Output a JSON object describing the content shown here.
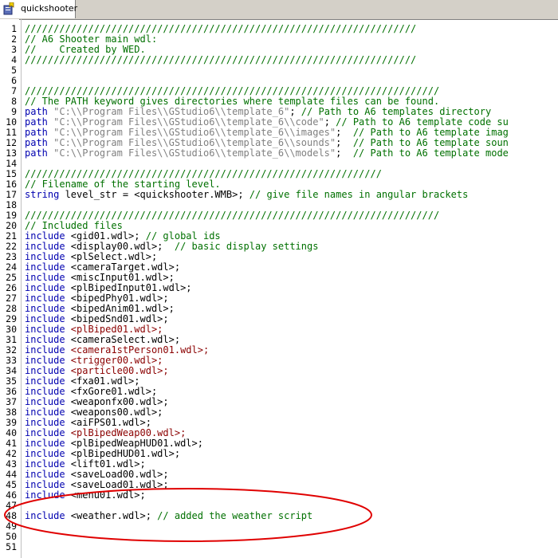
{
  "tab": {
    "label": "quickshooter",
    "icon": "script-file-icon"
  },
  "lines": [
    {
      "n": "1",
      "parts": [
        {
          "t": "////////////////////////////////////////////////////////////////////",
          "c": "comment"
        }
      ]
    },
    {
      "n": "2",
      "parts": [
        {
          "t": "// A6 Shooter main wdl:",
          "c": "comment"
        }
      ]
    },
    {
      "n": "3",
      "parts": [
        {
          "t": "//    Created by WED.",
          "c": "comment"
        }
      ]
    },
    {
      "n": "4",
      "parts": [
        {
          "t": "////////////////////////////////////////////////////////////////////",
          "c": "comment"
        }
      ]
    },
    {
      "n": "5",
      "parts": []
    },
    {
      "n": "6",
      "parts": []
    },
    {
      "n": "7",
      "parts": [
        {
          "t": "////////////////////////////////////////////////////////////////////////",
          "c": "comment"
        }
      ]
    },
    {
      "n": "8",
      "parts": [
        {
          "t": "// The PATH keyword gives directories where template files can be found.",
          "c": "comment"
        }
      ]
    },
    {
      "n": "9",
      "parts": [
        {
          "t": "path ",
          "c": "kw"
        },
        {
          "t": "\"C:\\\\Program Files\\\\GStudio6\\\\template_6\"",
          "c": "str"
        },
        {
          "t": "; ",
          "c": "plain"
        },
        {
          "t": "// Path to A6 templates directory",
          "c": "comment"
        }
      ]
    },
    {
      "n": "10",
      "parts": [
        {
          "t": "path ",
          "c": "kw"
        },
        {
          "t": "\"C:\\\\Program Files\\\\GStudio6\\\\template_6\\\\code\"",
          "c": "str"
        },
        {
          "t": "; ",
          "c": "plain"
        },
        {
          "t": "// Path to A6 template code su",
          "c": "comment"
        }
      ]
    },
    {
      "n": "11",
      "parts": [
        {
          "t": "path ",
          "c": "kw"
        },
        {
          "t": "\"C:\\\\Program Files\\\\GStudio6\\\\template_6\\\\images\"",
          "c": "str"
        },
        {
          "t": ";  ",
          "c": "plain"
        },
        {
          "t": "// Path to A6 template imag",
          "c": "comment"
        }
      ]
    },
    {
      "n": "12",
      "parts": [
        {
          "t": "path ",
          "c": "kw"
        },
        {
          "t": "\"C:\\\\Program Files\\\\GStudio6\\\\template_6\\\\sounds\"",
          "c": "str"
        },
        {
          "t": ";  ",
          "c": "plain"
        },
        {
          "t": "// Path to A6 template soun",
          "c": "comment"
        }
      ]
    },
    {
      "n": "13",
      "parts": [
        {
          "t": "path ",
          "c": "kw"
        },
        {
          "t": "\"C:\\\\Program Files\\\\GStudio6\\\\template_6\\\\models\"",
          "c": "str"
        },
        {
          "t": ";  ",
          "c": "plain"
        },
        {
          "t": "// Path to A6 template mode",
          "c": "comment"
        }
      ]
    },
    {
      "n": "14",
      "parts": []
    },
    {
      "n": "15",
      "parts": [
        {
          "t": "//////////////////////////////////////////////////////////////",
          "c": "comment"
        }
      ]
    },
    {
      "n": "16",
      "parts": [
        {
          "t": "// Filename of the starting level.",
          "c": "comment"
        }
      ]
    },
    {
      "n": "17",
      "parts": [
        {
          "t": "string ",
          "c": "kw"
        },
        {
          "t": "level_str = <quickshooter.WMB>; ",
          "c": "plain"
        },
        {
          "t": "// give file names in angular brackets",
          "c": "comment"
        }
      ]
    },
    {
      "n": "18",
      "parts": []
    },
    {
      "n": "19",
      "parts": [
        {
          "t": "////////////////////////////////////////////////////////////////////////",
          "c": "comment"
        }
      ]
    },
    {
      "n": "20",
      "parts": [
        {
          "t": "// Included files",
          "c": "comment"
        }
      ]
    },
    {
      "n": "21",
      "parts": [
        {
          "t": "include ",
          "c": "kw"
        },
        {
          "t": "<gid01.wdl>; ",
          "c": "plain"
        },
        {
          "t": "// global ids",
          "c": "comment"
        }
      ]
    },
    {
      "n": "22",
      "parts": [
        {
          "t": "include ",
          "c": "kw"
        },
        {
          "t": "<display00.wdl>;  ",
          "c": "plain"
        },
        {
          "t": "// basic display settings",
          "c": "comment"
        }
      ]
    },
    {
      "n": "23",
      "parts": [
        {
          "t": "include ",
          "c": "kw"
        },
        {
          "t": "<plSelect.wdl>;",
          "c": "plain"
        }
      ]
    },
    {
      "n": "24",
      "parts": [
        {
          "t": "include ",
          "c": "kw"
        },
        {
          "t": "<cameraTarget.wdl>;",
          "c": "plain"
        }
      ]
    },
    {
      "n": "25",
      "parts": [
        {
          "t": "include ",
          "c": "kw"
        },
        {
          "t": "<miscInput01.wdl>;",
          "c": "plain"
        }
      ]
    },
    {
      "n": "26",
      "parts": [
        {
          "t": "include ",
          "c": "kw"
        },
        {
          "t": "<plBipedInput01.wdl>;",
          "c": "plain"
        }
      ]
    },
    {
      "n": "27",
      "parts": [
        {
          "t": "include ",
          "c": "kw"
        },
        {
          "t": "<bipedPhy01.wdl>;",
          "c": "plain"
        }
      ]
    },
    {
      "n": "28",
      "parts": [
        {
          "t": "include ",
          "c": "kw"
        },
        {
          "t": "<bipedAnim01.wdl>;",
          "c": "plain"
        }
      ]
    },
    {
      "n": "29",
      "parts": [
        {
          "t": "include ",
          "c": "kw"
        },
        {
          "t": "<bipedSnd01.wdl>;",
          "c": "plain"
        }
      ]
    },
    {
      "n": "30",
      "parts": [
        {
          "t": "include ",
          "c": "kw"
        },
        {
          "t": "<plBiped01.wdl>;",
          "c": "red"
        }
      ]
    },
    {
      "n": "31",
      "parts": [
        {
          "t": "include ",
          "c": "kw"
        },
        {
          "t": "<cameraSelect.wdl>;",
          "c": "plain"
        }
      ]
    },
    {
      "n": "32",
      "parts": [
        {
          "t": "include ",
          "c": "kw"
        },
        {
          "t": "<camera1stPerson01.wdl>;",
          "c": "red"
        }
      ]
    },
    {
      "n": "33",
      "parts": [
        {
          "t": "include ",
          "c": "kw"
        },
        {
          "t": "<trigger00.wdl>;",
          "c": "red"
        }
      ]
    },
    {
      "n": "34",
      "parts": [
        {
          "t": "include ",
          "c": "kw"
        },
        {
          "t": "<particle00.wdl>;",
          "c": "red"
        }
      ]
    },
    {
      "n": "35",
      "parts": [
        {
          "t": "include ",
          "c": "kw"
        },
        {
          "t": "<fxa01.wdl>;",
          "c": "plain"
        }
      ]
    },
    {
      "n": "36",
      "parts": [
        {
          "t": "include ",
          "c": "kw"
        },
        {
          "t": "<fxGore01.wdl>;",
          "c": "plain"
        }
      ]
    },
    {
      "n": "37",
      "parts": [
        {
          "t": "include ",
          "c": "kw"
        },
        {
          "t": "<weaponfx00.wdl>;",
          "c": "plain"
        }
      ]
    },
    {
      "n": "38",
      "parts": [
        {
          "t": "include ",
          "c": "kw"
        },
        {
          "t": "<weapons00.wdl>;",
          "c": "plain"
        }
      ]
    },
    {
      "n": "39",
      "parts": [
        {
          "t": "include ",
          "c": "kw"
        },
        {
          "t": "<aiFPS01.wdl>;",
          "c": "plain"
        }
      ]
    },
    {
      "n": "40",
      "parts": [
        {
          "t": "include ",
          "c": "kw"
        },
        {
          "t": "<plBipedWeap00.wdl>;",
          "c": "red"
        }
      ]
    },
    {
      "n": "41",
      "parts": [
        {
          "t": "include ",
          "c": "kw"
        },
        {
          "t": "<plBipedWeapHUD01.wdl>;",
          "c": "plain"
        }
      ]
    },
    {
      "n": "42",
      "parts": [
        {
          "t": "include ",
          "c": "kw"
        },
        {
          "t": "<plBipedHUD01.wdl>;",
          "c": "plain"
        }
      ]
    },
    {
      "n": "43",
      "parts": [
        {
          "t": "include ",
          "c": "kw"
        },
        {
          "t": "<lift01.wdl>;",
          "c": "plain"
        }
      ]
    },
    {
      "n": "44",
      "parts": [
        {
          "t": "include ",
          "c": "kw"
        },
        {
          "t": "<saveLoad00.wdl>;",
          "c": "plain"
        }
      ]
    },
    {
      "n": "45",
      "parts": [
        {
          "t": "include ",
          "c": "kw"
        },
        {
          "t": "<saveLoad01.wdl>;",
          "c": "plain"
        }
      ]
    },
    {
      "n": "46",
      "parts": [
        {
          "t": "include ",
          "c": "kw"
        },
        {
          "t": "<menu01.wdl>;",
          "c": "plain"
        }
      ]
    },
    {
      "n": "47",
      "parts": []
    },
    {
      "n": "48",
      "parts": [
        {
          "t": "include ",
          "c": "kw"
        },
        {
          "t": "<weather.wdl>; ",
          "c": "plain"
        },
        {
          "t": "// added the weather script",
          "c": "comment"
        }
      ]
    },
    {
      "n": "49",
      "parts": []
    },
    {
      "n": "50",
      "parts": []
    },
    {
      "n": "51",
      "parts": []
    }
  ],
  "colors": {
    "comment": "#007000",
    "keyword": "#0000b0",
    "string": "#808080",
    "highlight": "#8b0000",
    "annotation": "#e00000"
  }
}
